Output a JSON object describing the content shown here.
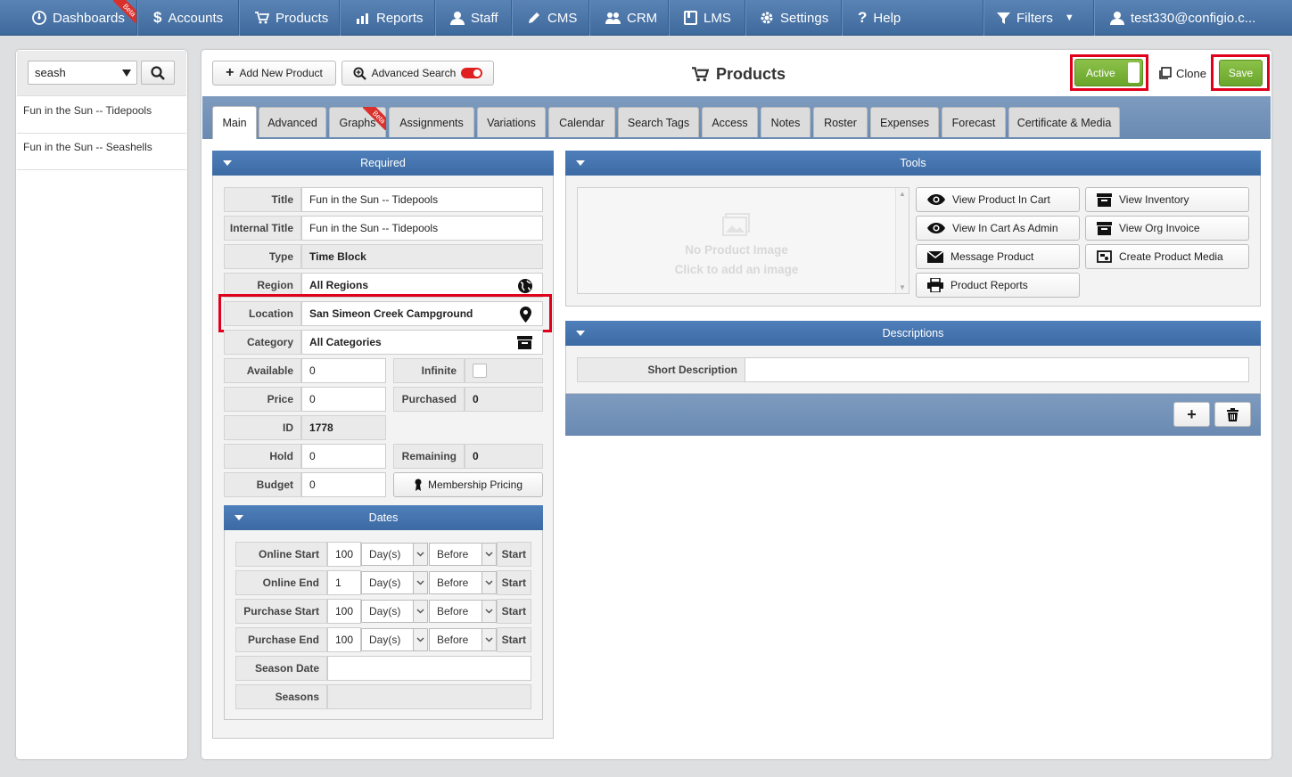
{
  "nav": {
    "dashboards": "Dashboards",
    "beta": "Beta",
    "accounts": "Accounts",
    "products": "Products",
    "reports": "Reports",
    "staff": "Staff",
    "cms": "CMS",
    "crm": "CRM",
    "lms": "LMS",
    "settings": "Settings",
    "help": "Help",
    "filters": "Filters",
    "user": "test330@configio.c..."
  },
  "search": {
    "value": "seash",
    "results": [
      "Fun in the Sun -- Tidepools",
      "Fun in the Sun -- Seashells"
    ]
  },
  "toolbar": {
    "add_new_product": "Add New Product",
    "advanced_search": "Advanced Search",
    "page_title": "Products",
    "active": "Active",
    "clone": "Clone",
    "save": "Save"
  },
  "tabs": [
    "Main",
    "Advanced",
    "Graphs",
    "Assignments",
    "Variations",
    "Calendar",
    "Search Tags",
    "Access",
    "Notes",
    "Roster",
    "Expenses",
    "Forecast",
    "Certificate & Media"
  ],
  "required": {
    "header": "Required",
    "title_label": "Title",
    "title_value": "Fun in the Sun -- Tidepools",
    "internal_title_label": "Internal Title",
    "internal_title_value": "Fun in the Sun -- Tidepools",
    "type_label": "Type",
    "type_value": "Time Block",
    "region_label": "Region",
    "region_value": "All Regions",
    "location_label": "Location",
    "location_value": "San Simeon Creek Campground",
    "category_label": "Category",
    "category_value": "All Categories",
    "available_label": "Available",
    "available_value": "0",
    "infinite_label": "Infinite",
    "price_label": "Price",
    "price_value": "0",
    "purchased_label": "Purchased",
    "purchased_value": "0",
    "id_label": "ID",
    "id_value": "1778",
    "hold_label": "Hold",
    "hold_value": "0",
    "remaining_label": "Remaining",
    "remaining_value": "0",
    "budget_label": "Budget",
    "budget_value": "0",
    "membership_pricing": "Membership Pricing"
  },
  "dates": {
    "header": "Dates",
    "rows": [
      {
        "label": "Online Start",
        "num": "100",
        "unit": "Day(s)",
        "rel": "Before",
        "anchor": "Start"
      },
      {
        "label": "Online End",
        "num": "1",
        "unit": "Day(s)",
        "rel": "Before",
        "anchor": "Start"
      },
      {
        "label": "Purchase Start",
        "num": "100",
        "unit": "Day(s)",
        "rel": "Before",
        "anchor": "Start"
      },
      {
        "label": "Purchase End",
        "num": "100",
        "unit": "Day(s)",
        "rel": "Before",
        "anchor": "Start"
      }
    ],
    "season_date_label": "Season Date",
    "seasons_label": "Seasons"
  },
  "tools": {
    "header": "Tools",
    "no_image": "No Product Image",
    "click_to_add": "Click to add an image",
    "view_in_cart": "View Product In Cart",
    "view_inventory": "View Inventory",
    "view_cart_admin": "View In Cart As Admin",
    "view_org_invoice": "View Org Invoice",
    "message_product": "Message Product",
    "create_media": "Create Product Media",
    "product_reports": "Product Reports"
  },
  "descriptions": {
    "header": "Descriptions",
    "short_label": "Short Description",
    "add": "+"
  }
}
